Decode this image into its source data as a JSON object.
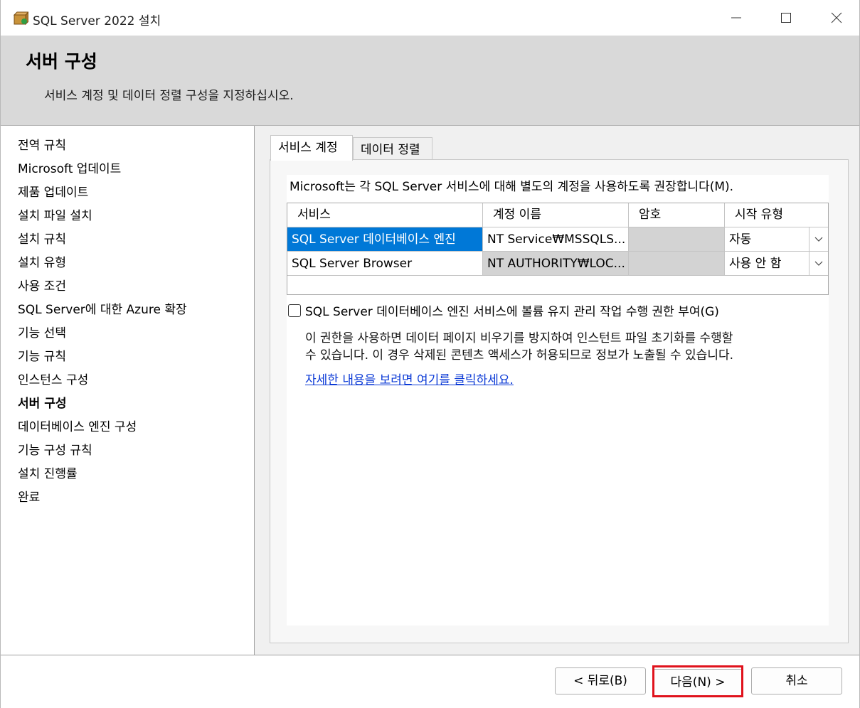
{
  "window": {
    "title": "SQL Server 2022 설치",
    "icon": "installer-box-icon"
  },
  "header": {
    "title": "서버 구성",
    "subtitle": "서비스 계정 및 데이터 정렬 구성을 지정하십시오."
  },
  "nav": {
    "items": [
      {
        "label": "전역 규칙"
      },
      {
        "label": "Microsoft 업데이트"
      },
      {
        "label": "제품 업데이트"
      },
      {
        "label": "설치 파일 설치"
      },
      {
        "label": "설치 규칙"
      },
      {
        "label": "설치 유형"
      },
      {
        "label": "사용 조건"
      },
      {
        "label": "SQL Server에 대한 Azure 확장"
      },
      {
        "label": "기능 선택"
      },
      {
        "label": "기능 규칙"
      },
      {
        "label": "인스턴스 구성"
      },
      {
        "label": "서버 구성",
        "active": true
      },
      {
        "label": "데이터베이스 엔진 구성"
      },
      {
        "label": "기능 구성 규칙"
      },
      {
        "label": "설치 진행률"
      },
      {
        "label": "완료"
      }
    ]
  },
  "tabs": [
    {
      "label": "서비스 계정",
      "active": true
    },
    {
      "label": "데이터 정렬",
      "active": false
    }
  ],
  "service_accounts": {
    "recommendation": "Microsoft는 각 SQL Server 서비스에 대해 별도의 계정을 사용하도록 권장합니다(M).",
    "columns": [
      "서비스",
      "계정 이름",
      "암호",
      "시작 유형"
    ],
    "rows": [
      {
        "service": "SQL Server 데이터베이스 엔진",
        "account": "NT Service₩MSSQLS...",
        "password": "",
        "startup": "자동",
        "selected": true
      },
      {
        "service": "SQL Server Browser",
        "account": "NT AUTHORITY₩LOC...",
        "password": "",
        "startup": "사용 안 함",
        "selected": false
      }
    ],
    "volume_checkbox": {
      "label": "SQL Server 데이터베이스 엔진 서비스에 볼륨 유지 관리 작업 수행 권한 부여(G)",
      "checked": false
    },
    "description_lines": [
      "이 권한을 사용하면 데이터 페이지 비우기를 방지하여 인스턴트 파일 초기화를 수행할",
      "수 있습니다. 이 경우 삭제된 콘텐츠 액세스가 허용되므로 정보가 노출될 수 있습니다."
    ],
    "link": "자세한 내용을 보려면 여기를 클릭하세요."
  },
  "footer": {
    "back": "< 뒤로(B)",
    "next": "다음(N) >",
    "cancel": "취소"
  },
  "colors": {
    "selection": "#0078d7",
    "highlight": "#e0121c",
    "link": "#0b3ad6"
  }
}
